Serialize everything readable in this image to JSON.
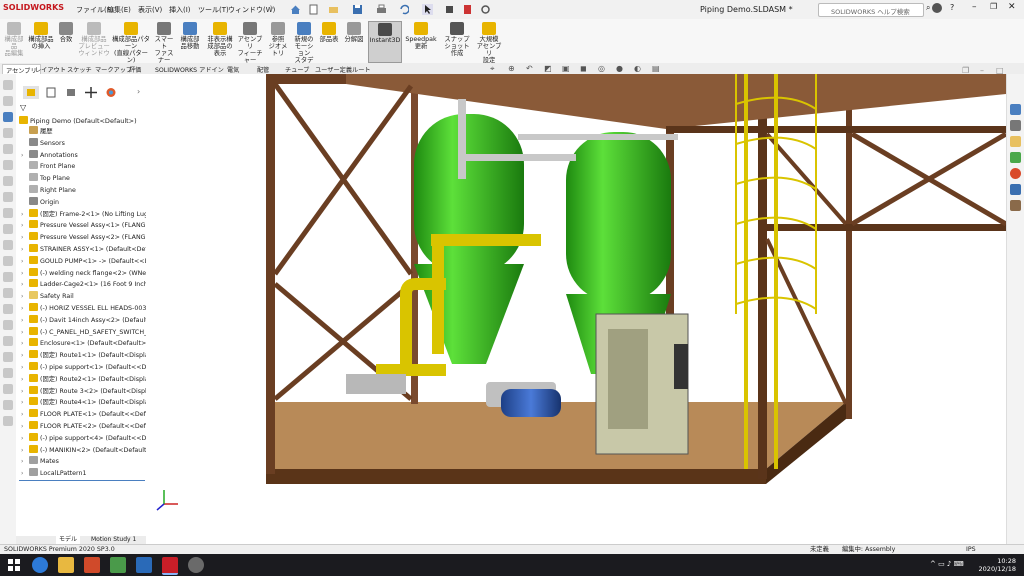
{
  "app": {
    "logo": "SOLIDWORKS",
    "document_title": "Piping Demo.SLDASM *",
    "help_search_placeholder": "SOLIDWORKS ヘルプ検索"
  },
  "menu": [
    "ファイル(F)",
    "編集(E)",
    "表示(V)",
    "挿入(I)",
    "ツール(T)",
    "ウィンドウ(W)"
  ],
  "ribbon": {
    "buttons": [
      {
        "label": "構成部品\n品編集",
        "dim": true
      },
      {
        "label": "構成部品\nの挿入",
        "dim": false
      },
      {
        "label": "合致",
        "dim": false
      },
      {
        "label": "構成部品\nプレビュー\nウィンドウ",
        "dim": true
      },
      {
        "label": "構成部品パターン\n(直線パターン)",
        "dim": false
      },
      {
        "label": "スマート\nファスナー\n挿入",
        "dim": false
      },
      {
        "label": "構成部\n品移動",
        "dim": false
      },
      {
        "label": "非表示構\n成部品の\n表示",
        "dim": false
      },
      {
        "label": "アセンブリ\nフィーチャー",
        "dim": false
      },
      {
        "label": "参照\nジオメトリ",
        "dim": false
      },
      {
        "label": "新規の\nモーション\nスタディ",
        "dim": false
      },
      {
        "label": "部品表",
        "dim": false
      },
      {
        "label": "分解図",
        "dim": false
      },
      {
        "label": "Instant3D",
        "dim": false
      },
      {
        "label": "Speedpak\n更新",
        "dim": false
      },
      {
        "label": "スナップショット\n作成",
        "dim": false
      },
      {
        "label": "大規模\nアセンブリ\n設定",
        "dim": false
      }
    ]
  },
  "tabs": [
    "アセンブリ",
    "レイアウト",
    "スケッチ",
    "マークアップ",
    "評価",
    "SOLIDWORKS アドイン",
    "電気",
    "配管",
    "チューブ",
    "ユーザー定義ルート"
  ],
  "tree": {
    "root": "Piping Demo  (Default<Default>)",
    "items": [
      {
        "label": "履歴",
        "arrow": false,
        "color": "#c8a050"
      },
      {
        "label": "Sensors",
        "arrow": false,
        "color": "#8a8a8a"
      },
      {
        "label": "Annotations",
        "arrow": true,
        "color": "#8a8a8a"
      },
      {
        "label": "Front Plane",
        "arrow": false,
        "color": "#b0b0b0"
      },
      {
        "label": "Top Plane",
        "arrow": false,
        "color": "#b0b0b0"
      },
      {
        "label": "Right Plane",
        "arrow": false,
        "color": "#b0b0b0"
      },
      {
        "label": "Origin",
        "arrow": false,
        "color": "#888888"
      },
      {
        "label": "(固定) Frame-2<1> (No Lifting Lugs-",
        "arrow": true,
        "color": "#e8b400"
      },
      {
        "label": "Pressure Vessel Assy<1> (FLANGE O",
        "arrow": true,
        "color": "#e8b400"
      },
      {
        "label": "Pressure Vessel Assy<2> (FLANGE O",
        "arrow": true,
        "color": "#e8b400"
      },
      {
        "label": "STRAINER ASSY<1> (Default<Default",
        "arrow": true,
        "color": "#e8b400"
      },
      {
        "label": "GOULD PUMP<1> -> (Default<<Def",
        "arrow": true,
        "color": "#e8b400"
      },
      {
        "label": "(-) welding neck flange<2> (WNeck",
        "arrow": true,
        "color": "#e8b400"
      },
      {
        "label": "Ladder-Cage2<1> (16 Foot 9 Inch<A",
        "arrow": true,
        "color": "#e8b400"
      },
      {
        "label": "Safety Rail",
        "arrow": true,
        "color": "#e8c860"
      },
      {
        "label": "(-) HORIZ VESSEL ELL HEADS-003<1",
        "arrow": true,
        "color": "#e8b400"
      },
      {
        "label": "(-) Davit 14inch Assy<2> (Default<D",
        "arrow": true,
        "color": "#e8b400"
      },
      {
        "label": "(-) C_PANEL_HD_SAFETY_SWITCH_te",
        "arrow": true,
        "color": "#e8b400"
      },
      {
        "label": "Enclosure<1> (Default<Default>)",
        "arrow": true,
        "color": "#e8b400"
      },
      {
        "label": "(固定) Route1<1> (Default<Display S",
        "arrow": true,
        "color": "#e8b400"
      },
      {
        "label": "(-) pipe support<1> (Default<<Defa",
        "arrow": true,
        "color": "#e8b400"
      },
      {
        "label": "(固定) Route2<1> (Default<Display S",
        "arrow": true,
        "color": "#e8b400"
      },
      {
        "label": "(固定) Route 3<2> (Default<Display",
        "arrow": true,
        "color": "#e8b400"
      },
      {
        "label": "(固定) Route4<1> (Default<Display S",
        "arrow": true,
        "color": "#e8b400"
      },
      {
        "label": "FLOOR PLATE<1> (Default<<Default",
        "arrow": true,
        "color": "#e8b400"
      },
      {
        "label": "FLOOR PLATE<2> (Default<<Default",
        "arrow": true,
        "color": "#e8b400"
      },
      {
        "label": "(-) pipe support<4> (Default<<Defa",
        "arrow": true,
        "color": "#e8b400"
      },
      {
        "label": "(-) MANIKIN<2> (Default<Default_D",
        "arrow": true,
        "color": "#e8b400"
      },
      {
        "label": "Mates",
        "arrow": true,
        "color": "#a0a0a0"
      },
      {
        "label": "LocalLPattern1",
        "arrow": true,
        "color": "#a0a0a0"
      }
    ]
  },
  "bottom_tabs": [
    "モデル",
    "Motion Study 1"
  ],
  "status": {
    "product": "SOLIDWORKS Premium 2020 SP3.0",
    "defined": "未定義",
    "editing": "編集中: Assembly",
    "units": "IPS"
  },
  "clock": {
    "time": "10:28",
    "date": "2020/12/18"
  },
  "colors": {
    "vessel": "#3fc21f",
    "frame": "#7a4a2e",
    "pipe_yellow": "#d9c400",
    "pump_blue": "#2a55a8"
  }
}
